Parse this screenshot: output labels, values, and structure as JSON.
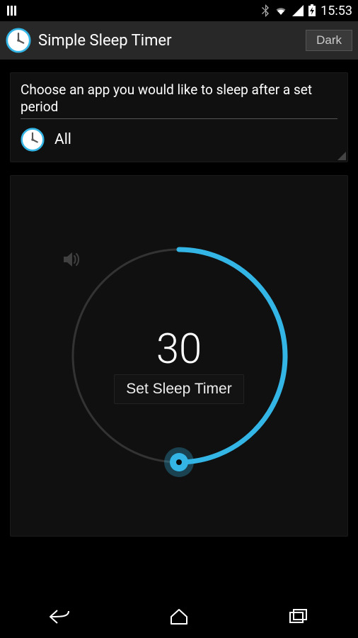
{
  "status": {
    "time": "15:53"
  },
  "header": {
    "title": "Simple Sleep Timer",
    "themeButton": "Dark"
  },
  "chooser": {
    "prompt": "Choose an app you would like to sleep after a set period",
    "selected": "All"
  },
  "timer": {
    "minutes": "30",
    "setButton": "Set Sleep Timer",
    "accentColor": "#33b5e5",
    "progressFraction": 0.5
  }
}
